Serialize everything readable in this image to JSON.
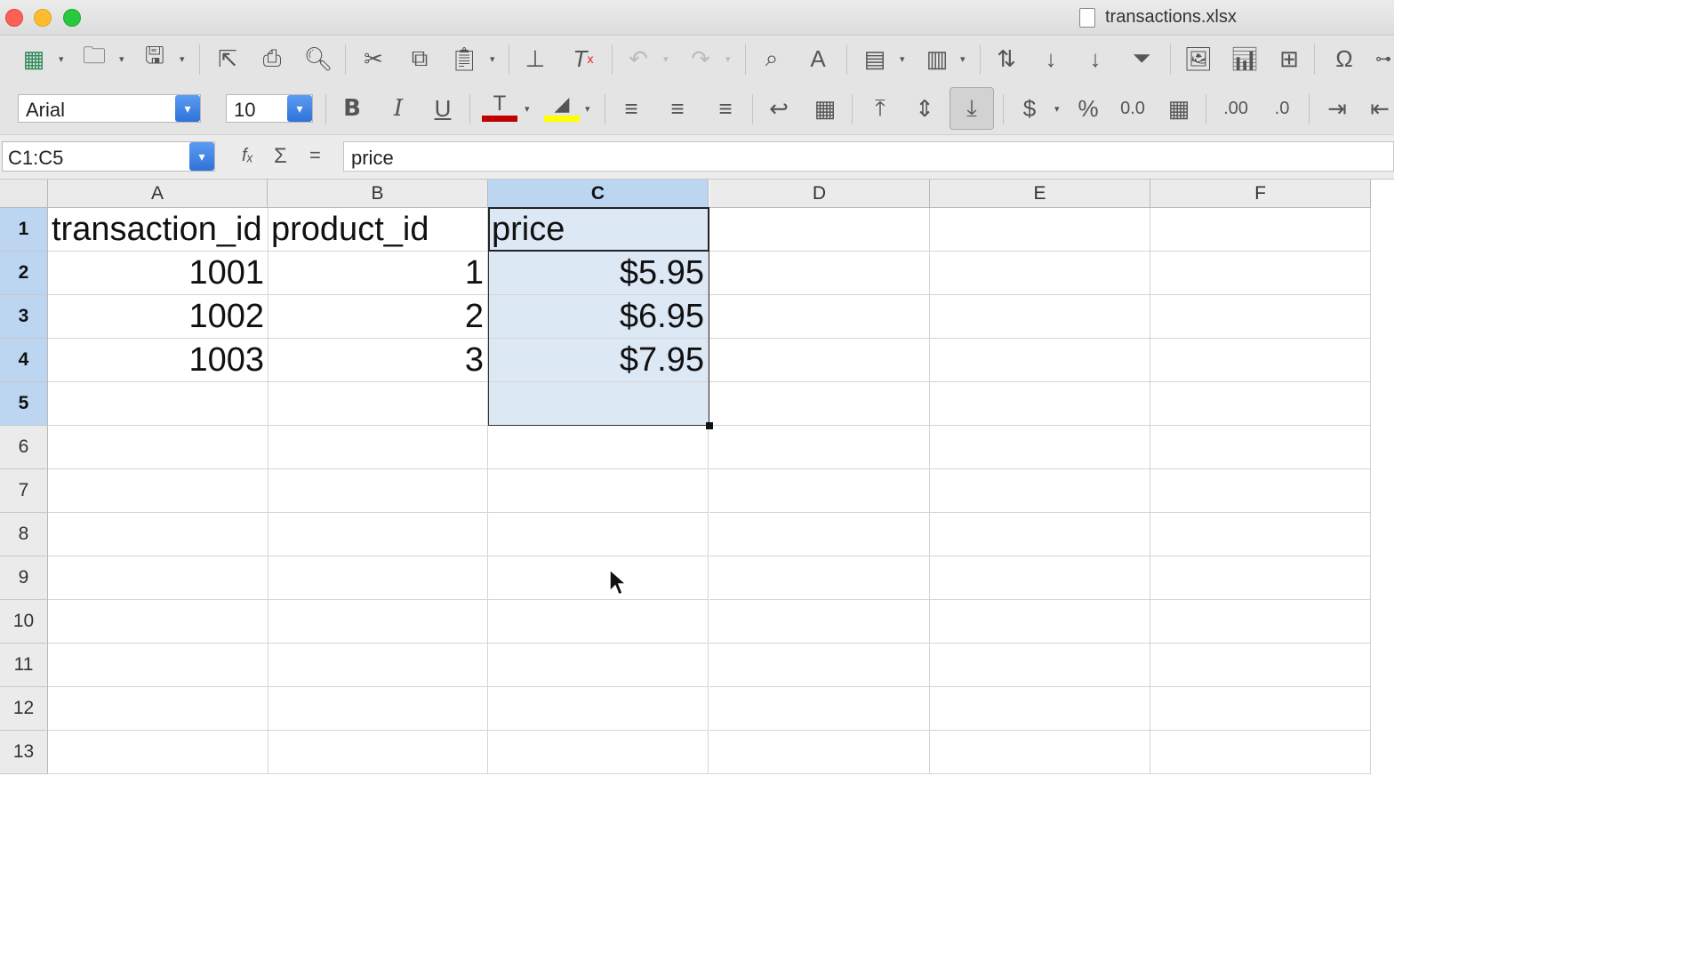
{
  "window": {
    "file_name": "transactions.xlsx"
  },
  "toolbar": {
    "font_name": "Arial",
    "font_size": "10"
  },
  "formula_bar": {
    "name_box": "C1:C5",
    "fx_label": "fₓ",
    "sum_label": "Σ",
    "equals_label": "=",
    "content": "price"
  },
  "sheet": {
    "columns": [
      "A",
      "B",
      "C",
      "D",
      "E",
      "F"
    ],
    "rows": [
      "1",
      "2",
      "3",
      "4",
      "5",
      "6",
      "7",
      "8",
      "9",
      "10",
      "11",
      "12",
      "13"
    ],
    "selected_column": "C",
    "selected_rows": [
      "1",
      "2",
      "3",
      "4",
      "5"
    ],
    "cells": {
      "A1": "transaction_id",
      "B1": "product_id",
      "C1": "price",
      "A2": "1001",
      "B2": "1",
      "C2": "$5.95",
      "A3": "1002",
      "B3": "2",
      "C3": "$6.95",
      "A4": "1003",
      "B4": "3",
      "C4": "$7.95"
    }
  },
  "colors": {
    "selection_fill": "#dde8f5",
    "header_selected": "#bcd6f2",
    "font_color_bar": "#c00000",
    "highlight_bar": "#ffff00",
    "combo_button": "#2f73d9"
  }
}
